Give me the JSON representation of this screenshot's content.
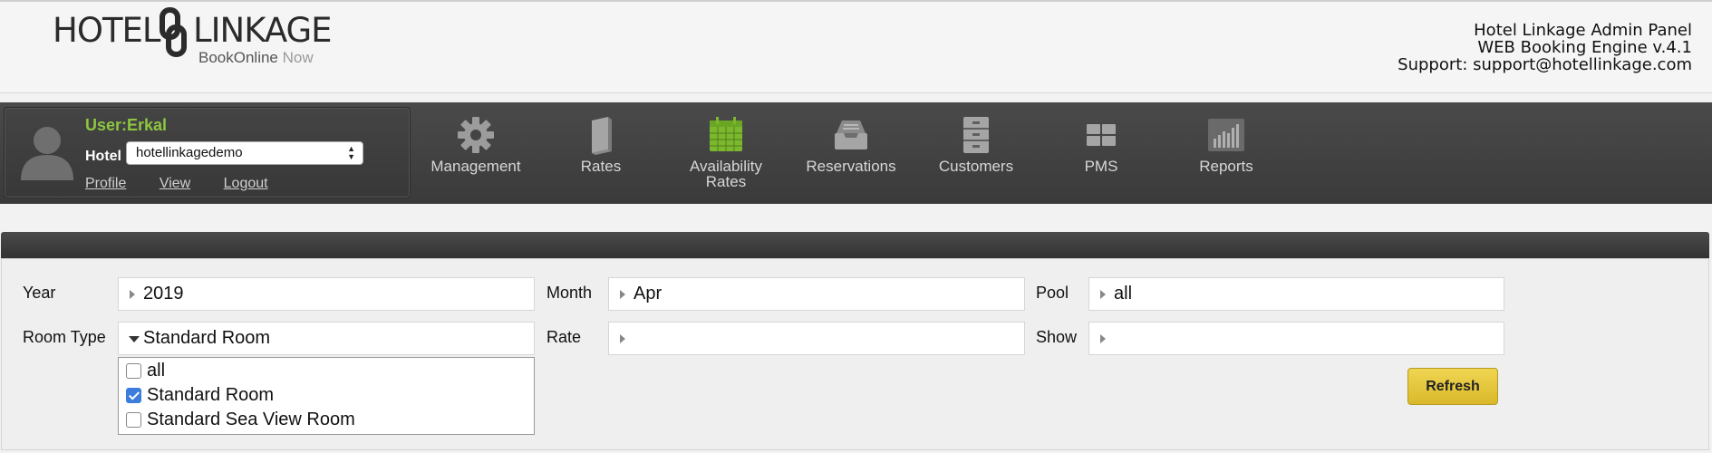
{
  "header": {
    "logo": {
      "word_left": "HOTEL",
      "word_right": "LINKAGE",
      "tagline_main": "BookOnline",
      "tagline_accent": "Now"
    },
    "info": {
      "line1": "Hotel Linkage Admin Panel",
      "line2": "WEB Booking Engine v.4.1",
      "line3": "Support: support@hotellinkage.com"
    }
  },
  "user_panel": {
    "username": "User:Erkal",
    "hotel_label": "Hotel",
    "hotel_selected": "hotellinkagedemo",
    "links": {
      "profile": "Profile",
      "view": "View",
      "logout": "Logout"
    }
  },
  "nav": {
    "management": "Management",
    "rates": "Rates",
    "availability_line1": "Availability",
    "availability_line2": "Rates",
    "reservations": "Reservations",
    "customers": "Customers",
    "pms": "PMS",
    "reports": "Reports"
  },
  "filters": {
    "year": {
      "label": "Year",
      "value": "2019"
    },
    "month": {
      "label": "Month",
      "value": "Apr"
    },
    "pool": {
      "label": "Pool",
      "value": "all"
    },
    "room_type": {
      "label": "Room Type",
      "value": "Standard Room",
      "options": [
        {
          "label": "all",
          "checked": false
        },
        {
          "label": "Standard Room",
          "checked": true
        },
        {
          "label": "Standard Sea View Room",
          "checked": false
        }
      ]
    },
    "rate": {
      "label": "Rate",
      "value": ""
    },
    "show": {
      "label": "Show",
      "value": ""
    }
  },
  "refresh_label": "Refresh",
  "colors": {
    "username_green": "#8dc63f",
    "availability_icon_green": "#7cb82f",
    "refresh_yellow": "#e6c83b",
    "checkbox_blue": "#3b7ddd"
  }
}
